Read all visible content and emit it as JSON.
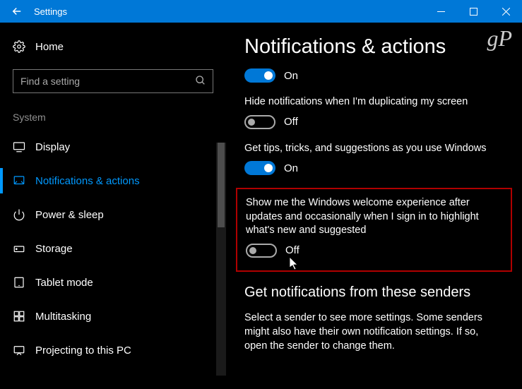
{
  "titlebar": {
    "title": "Settings"
  },
  "watermark": "gP",
  "sidebar": {
    "home": "Home",
    "search_placeholder": "Find a setting",
    "category": "System",
    "items": [
      {
        "label": "Display"
      },
      {
        "label": "Notifications & actions"
      },
      {
        "label": "Power & sleep"
      },
      {
        "label": "Storage"
      },
      {
        "label": "Tablet mode"
      },
      {
        "label": "Multitasking"
      },
      {
        "label": "Projecting to this PC"
      }
    ]
  },
  "content": {
    "heading": "Notifications & actions",
    "settings": [
      {
        "state": "On"
      },
      {
        "desc": "Hide notifications when I'm duplicating my screen",
        "state": "Off"
      },
      {
        "desc": "Get tips, tricks, and suggestions as you use Windows",
        "state": "On"
      },
      {
        "desc": "Show me the Windows welcome experience after updates and occasionally when I sign in to highlight what's new and suggested",
        "state": "Off"
      }
    ],
    "senders_heading": "Get notifications from these senders",
    "senders_body": "Select a sender to see more settings. Some senders might also have their own notification settings. If so, open the sender to change them."
  }
}
